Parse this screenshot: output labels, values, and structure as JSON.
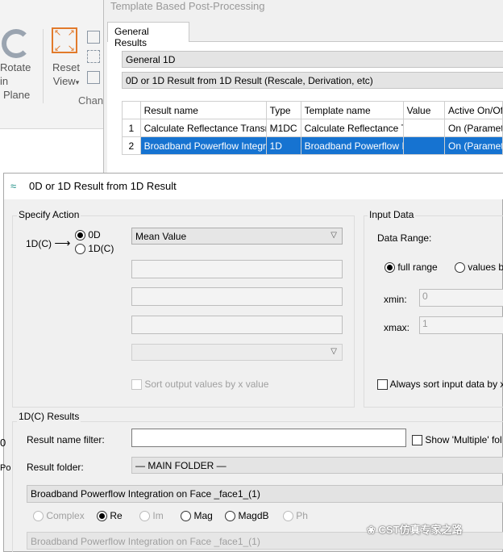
{
  "ribbon": {
    "rotate_label_1": "Rotate in",
    "rotate_label_2": "Plane",
    "reset_label_1": "Reset",
    "reset_label_2": "View",
    "reset_dropdown_glyph": "▾",
    "group_label": "Chan"
  },
  "template_window": {
    "title": "Template Based Post-Processing",
    "tab_label": "General Results",
    "category_combo": "General 1D",
    "type_combo": "0D or 1D Result from 1D Result (Rescale, Derivation, etc)",
    "columns": [
      "",
      "Result name",
      "Type",
      "Template name",
      "Value",
      "Active On/Off"
    ],
    "rows": [
      [
        "1",
        "Calculate Reflectance Transmittance",
        "M1DC",
        "Calculate Reflectance T",
        "",
        "On (Parametric)"
      ],
      [
        "2",
        "Broadband Powerflow Integration",
        "1D",
        "Broadband Powerflow Integration",
        "",
        "On (Parametric)"
      ]
    ]
  },
  "dialog": {
    "title": "0D or 1D Result from 1D Result",
    "specify_action": {
      "group_label": "Specify Action",
      "input_label": "1D(C)",
      "arrow": "⟶",
      "option_0d": "0D",
      "option_1dc": "1D(C)",
      "selected_option": "0D",
      "action_combo": "Mean Value",
      "sort_label": "Sort output values by x value"
    },
    "input_data": {
      "group_label": "Input Data",
      "data_range_label": "Data Range:",
      "option_full": "full range",
      "option_values": "values b",
      "xmin_label": "xmin:",
      "xmin_value": "0",
      "xmax_label": "xmax:",
      "xmax_value": "1",
      "always_sort_label": "Always sort input data by x v"
    },
    "results": {
      "group_label": "1D(C) Results",
      "filter_label": "Result name filter:",
      "filter_value": "",
      "show_multiple_label": "Show 'Multiple' fol",
      "folder_label": "Result folder:",
      "folder_value": "— MAIN FOLDER —",
      "selected_result": "Broadband Powerflow Integration on Face _face1_(1)",
      "components": [
        "Complex",
        "Re",
        "Im",
        "Mag",
        "MagdB",
        "Ph"
      ],
      "selected_component": "Re",
      "result_footer": "Broadband Powerflow Integration on Face _face1_(1)"
    }
  },
  "watermark": "CST仿真专家之路",
  "background_fragments": [
    "0",
    "Po"
  ]
}
